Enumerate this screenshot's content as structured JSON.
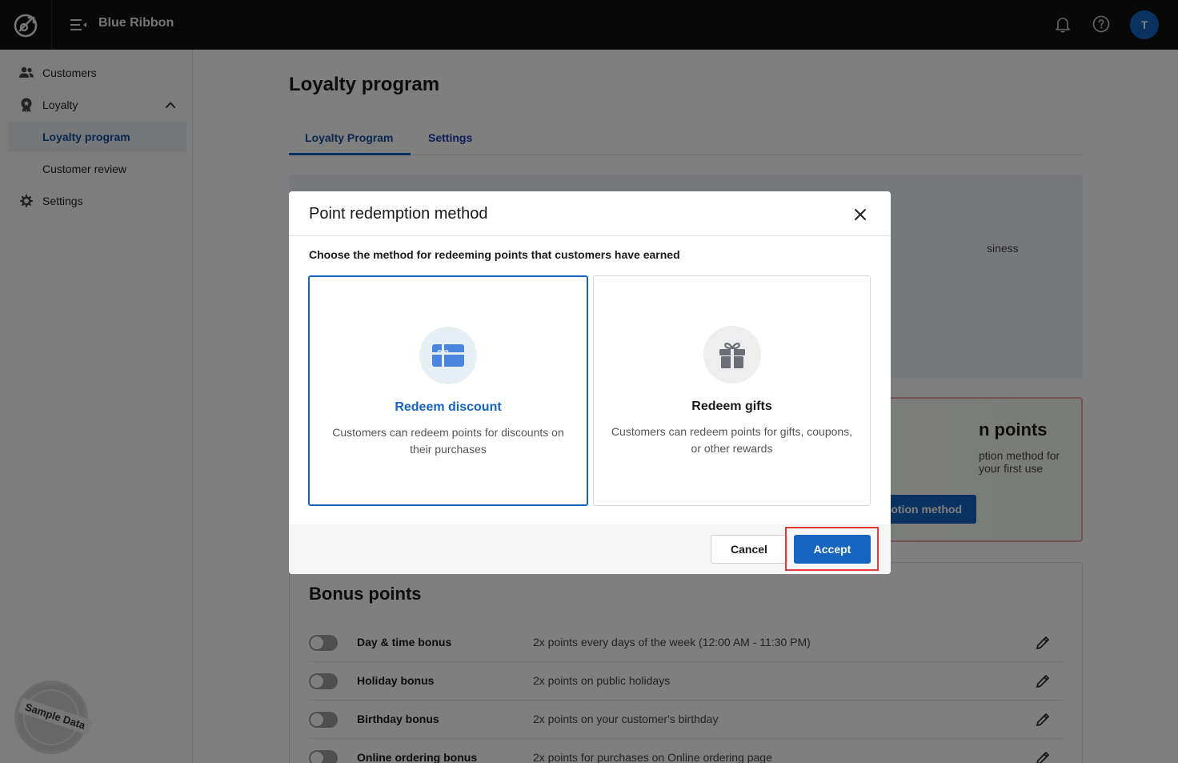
{
  "app": {
    "name": "Blue Ribbon",
    "avatar_initial": "T"
  },
  "sidebar": {
    "items": [
      {
        "label": "Customers",
        "icon": "customers-icon"
      },
      {
        "label": "Loyalty",
        "icon": "loyalty-badge-icon"
      },
      {
        "label": "Loyalty program",
        "active": true
      },
      {
        "label": "Customer review"
      },
      {
        "label": "Settings",
        "icon": "gear-icon"
      }
    ],
    "stamp_label": "Sample Data"
  },
  "page": {
    "title": "Loyalty program",
    "tabs": [
      {
        "label": "Loyalty Program",
        "active": true
      },
      {
        "label": "Settings"
      }
    ],
    "hero_snippet": "siness",
    "redeem": {
      "title_fragment": "n points",
      "subtitle_fragment": "ption method for your first use",
      "button_fragment": "otion method"
    },
    "bonus": {
      "title": "Bonus points",
      "rows": [
        {
          "name": "Day & time bonus",
          "desc": "2x points every days of the week (12:00 AM - 11:30 PM)"
        },
        {
          "name": "Holiday bonus",
          "desc": "2x points on public holidays"
        },
        {
          "name": "Birthday bonus",
          "desc": "2x points on your customer's birthday"
        },
        {
          "name": "Online ordering bonus",
          "desc": "2x points for purchases on Online ordering page"
        }
      ]
    }
  },
  "modal": {
    "title": "Point redemption method",
    "prompt": "Choose the method for redeeming points that customers have earned",
    "options": [
      {
        "title": "Redeem discount",
        "desc": "Customers can redeem points for discounts on their purchases",
        "icon": "gift-card-icon",
        "selected": true
      },
      {
        "title": "Redeem gifts",
        "desc": "Customers can redeem points for gifts, coupons, or other rewards",
        "icon": "gift-box-icon",
        "selected": false
      }
    ],
    "cancel_label": "Cancel",
    "accept_label": "Accept"
  },
  "colors": {
    "accent": "#1565c0",
    "topbar": "#111111",
    "highlight": "#e53935"
  }
}
